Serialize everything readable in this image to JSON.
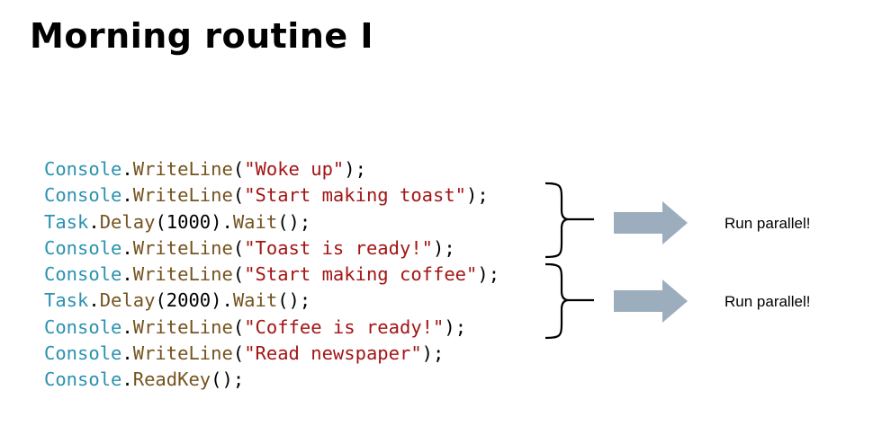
{
  "slide": {
    "title": "Morning routine I"
  },
  "colors": {
    "type": "#2b91af",
    "method": "#74531f",
    "string": "#a31515",
    "number": "#000000",
    "punctuation": "#000000",
    "arrow": "#9cadbd"
  },
  "code_lines": [
    [
      {
        "t": "Console",
        "k": "type"
      },
      {
        "t": ".",
        "k": "punc"
      },
      {
        "t": "WriteLine",
        "k": "method"
      },
      {
        "t": "(",
        "k": "punc"
      },
      {
        "t": "\"Woke up\"",
        "k": "str"
      },
      {
        "t": ");",
        "k": "punc"
      }
    ],
    [
      {
        "t": "Console",
        "k": "type"
      },
      {
        "t": ".",
        "k": "punc"
      },
      {
        "t": "WriteLine",
        "k": "method"
      },
      {
        "t": "(",
        "k": "punc"
      },
      {
        "t": "\"Start making toast\"",
        "k": "str"
      },
      {
        "t": ");",
        "k": "punc"
      }
    ],
    [
      {
        "t": "Task",
        "k": "type"
      },
      {
        "t": ".",
        "k": "punc"
      },
      {
        "t": "Delay",
        "k": "method"
      },
      {
        "t": "(",
        "k": "punc"
      },
      {
        "t": "1000",
        "k": "num"
      },
      {
        "t": ").",
        "k": "punc"
      },
      {
        "t": "Wait",
        "k": "method"
      },
      {
        "t": "();",
        "k": "punc"
      }
    ],
    [
      {
        "t": "Console",
        "k": "type"
      },
      {
        "t": ".",
        "k": "punc"
      },
      {
        "t": "WriteLine",
        "k": "method"
      },
      {
        "t": "(",
        "k": "punc"
      },
      {
        "t": "\"Toast is ready!\"",
        "k": "str"
      },
      {
        "t": ");",
        "k": "punc"
      }
    ],
    [
      {
        "t": "Console",
        "k": "type"
      },
      {
        "t": ".",
        "k": "punc"
      },
      {
        "t": "WriteLine",
        "k": "method"
      },
      {
        "t": "(",
        "k": "punc"
      },
      {
        "t": "\"Start making coffee\"",
        "k": "str"
      },
      {
        "t": ");",
        "k": "punc"
      }
    ],
    [
      {
        "t": "Task",
        "k": "type"
      },
      {
        "t": ".",
        "k": "punc"
      },
      {
        "t": "Delay",
        "k": "method"
      },
      {
        "t": "(",
        "k": "punc"
      },
      {
        "t": "2000",
        "k": "num"
      },
      {
        "t": ").",
        "k": "punc"
      },
      {
        "t": "Wait",
        "k": "method"
      },
      {
        "t": "();",
        "k": "punc"
      }
    ],
    [
      {
        "t": "Console",
        "k": "type"
      },
      {
        "t": ".",
        "k": "punc"
      },
      {
        "t": "WriteLine",
        "k": "method"
      },
      {
        "t": "(",
        "k": "punc"
      },
      {
        "t": "\"Coffee is ready!\"",
        "k": "str"
      },
      {
        "t": ");",
        "k": "punc"
      }
    ],
    [
      {
        "t": "Console",
        "k": "type"
      },
      {
        "t": ".",
        "k": "punc"
      },
      {
        "t": "WriteLine",
        "k": "method"
      },
      {
        "t": "(",
        "k": "punc"
      },
      {
        "t": "\"Read newspaper\"",
        "k": "str"
      },
      {
        "t": ");",
        "k": "punc"
      }
    ],
    [
      {
        "t": "Console",
        "k": "type"
      },
      {
        "t": ".",
        "k": "punc"
      },
      {
        "t": "ReadKey",
        "k": "method"
      },
      {
        "t": "();",
        "k": "punc"
      }
    ]
  ],
  "annotations": [
    {
      "label": "Run parallel!"
    },
    {
      "label": "Run parallel!"
    }
  ]
}
